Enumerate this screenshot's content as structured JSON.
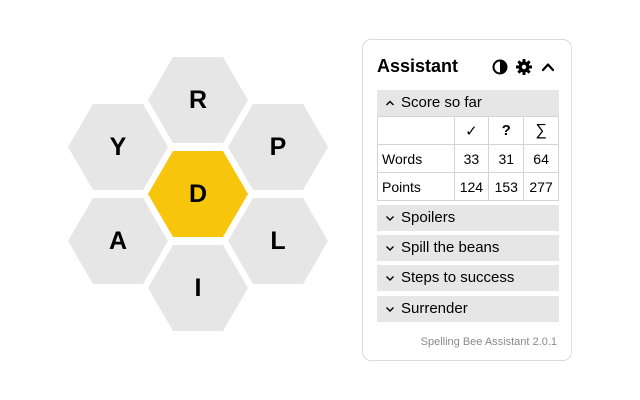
{
  "colors": {
    "outer_hex": "#e6e6e6",
    "center_hex": "#f7c60c",
    "panel_border": "#dcdcdc",
    "section_bg": "#e6e6e6"
  },
  "hive": {
    "center": "D",
    "top": "R",
    "upper_left": "Y",
    "upper_right": "P",
    "lower_left": "A",
    "lower_right": "L",
    "bottom": "I"
  },
  "assistant": {
    "title": "Assistant",
    "icons": [
      "contrast-icon",
      "gear-icon",
      "chevron-up-icon"
    ],
    "score_section": {
      "label": "Score so far",
      "columns": [
        "✓",
        "?",
        "∑"
      ],
      "rows": [
        {
          "label": "Words",
          "values": [
            "33",
            "31",
            "64"
          ]
        },
        {
          "label": "Points",
          "values": [
            "124",
            "153",
            "277"
          ]
        }
      ]
    },
    "sections": [
      "Spoilers",
      "Spill the beans",
      "Steps to success",
      "Surrender"
    ],
    "version": "Spelling Bee Assistant 2.0.1"
  }
}
